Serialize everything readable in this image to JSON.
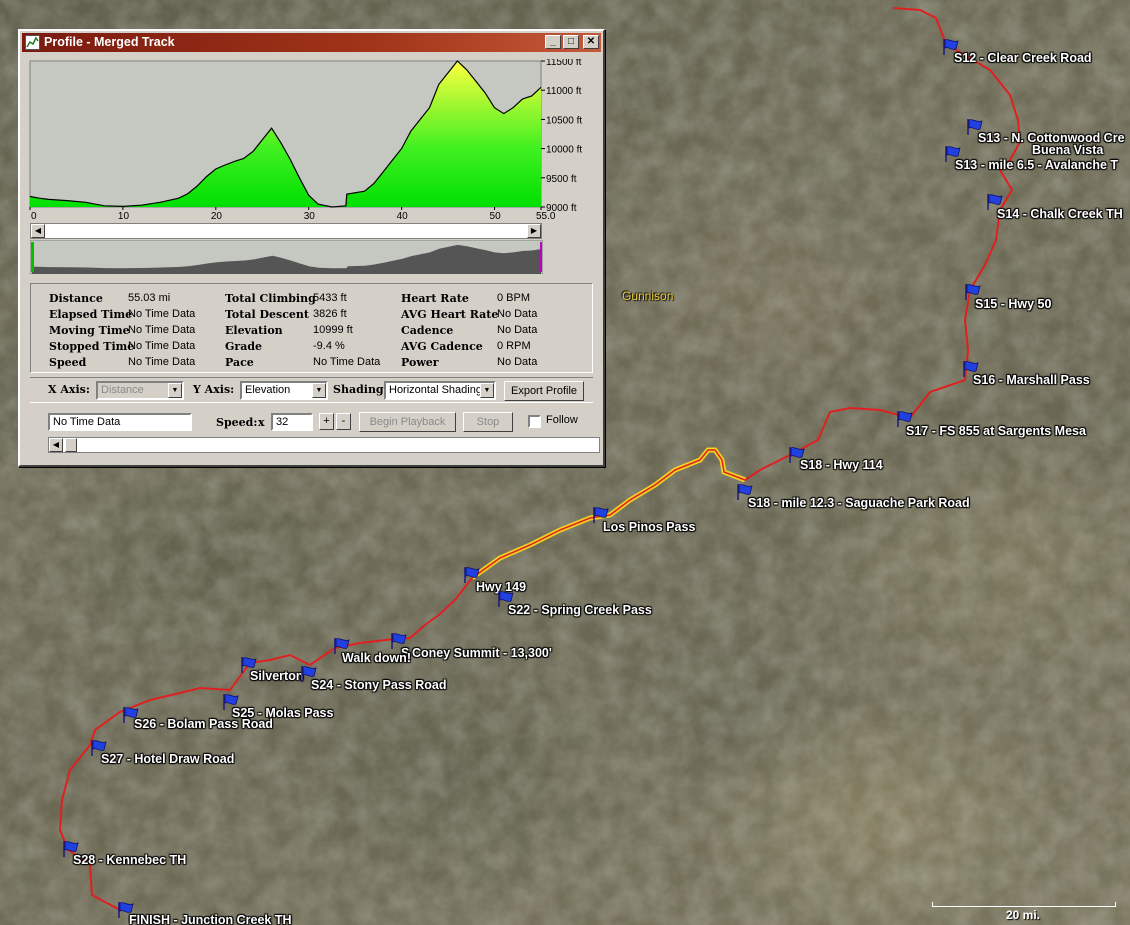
{
  "window": {
    "title": "Profile - Merged Track",
    "minimize_glyph": "_",
    "maximize_glyph": "□",
    "close_glyph": "✕"
  },
  "profile_chart": {
    "y_tick_labels": [
      "11500 ft",
      "11000 ft",
      "10500 ft",
      "10000 ft",
      "9500 ft",
      "9000 ft"
    ],
    "x_tick_labels": [
      "0",
      "10",
      "20",
      "30",
      "40",
      "50",
      "55.0"
    ],
    "x_range": [
      0,
      55
    ],
    "y_range": [
      9000,
      11500
    ],
    "elevation_ft": [
      [
        0,
        9180
      ],
      [
        1,
        9150
      ],
      [
        2,
        9130
      ],
      [
        4,
        9110
      ],
      [
        6,
        9080
      ],
      [
        8,
        9020
      ],
      [
        10,
        9010
      ],
      [
        12,
        9030
      ],
      [
        14,
        9080
      ],
      [
        16,
        9150
      ],
      [
        17,
        9230
      ],
      [
        18,
        9360
      ],
      [
        19,
        9520
      ],
      [
        20,
        9650
      ],
      [
        21,
        9720
      ],
      [
        22,
        9780
      ],
      [
        23,
        9830
      ],
      [
        24,
        9950
      ],
      [
        25,
        10150
      ],
      [
        26,
        10350
      ],
      [
        27,
        10100
      ],
      [
        28,
        9820
      ],
      [
        29,
        9500
      ],
      [
        30,
        9200
      ],
      [
        31,
        9050
      ],
      [
        32.5,
        9000
      ],
      [
        34,
        9020
      ],
      [
        34.1,
        9220
      ],
      [
        36,
        9270
      ],
      [
        37,
        9400
      ],
      [
        38,
        9600
      ],
      [
        39,
        9800
      ],
      [
        40,
        10000
      ],
      [
        41,
        10300
      ],
      [
        42,
        10500
      ],
      [
        43,
        10700
      ],
      [
        44,
        11100
      ],
      [
        45,
        11300
      ],
      [
        46,
        11500
      ],
      [
        47,
        11350
      ],
      [
        48,
        11150
      ],
      [
        49,
        10950
      ],
      [
        50,
        10700
      ],
      [
        51,
        10600
      ],
      [
        52,
        10700
      ],
      [
        53,
        10850
      ],
      [
        54,
        10900
      ],
      [
        55,
        11050
      ]
    ]
  },
  "stats": [
    {
      "label": "Distance",
      "value": "55.03 mi"
    },
    {
      "label": "Elapsed Time",
      "value": "No Time Data"
    },
    {
      "label": "Moving Time",
      "value": "No Time Data"
    },
    {
      "label": "Stopped Time",
      "value": "No Time Data"
    },
    {
      "label": "Speed",
      "value": "No Time Data"
    },
    {
      "label": "Total Climbing",
      "value": "5433 ft"
    },
    {
      "label": "Total Descent",
      "value": "3826 ft"
    },
    {
      "label": "Elevation",
      "value": "10999 ft"
    },
    {
      "label": "Grade",
      "value": "-9.4 %"
    },
    {
      "label": "Pace",
      "value": "No Time Data"
    },
    {
      "label": "Heart Rate",
      "value": "0 BPM"
    },
    {
      "label": "AVG Heart Rate",
      "value": "No Data"
    },
    {
      "label": "Cadence",
      "value": "No Data"
    },
    {
      "label": "AVG Cadence",
      "value": "0 RPM"
    },
    {
      "label": "Power",
      "value": "No Data"
    }
  ],
  "controls": {
    "x_axis_label": "X Axis:",
    "x_axis_value": "Distance",
    "y_axis_label": "Y Axis:",
    "y_axis_value": "Elevation",
    "shading_label": "Shading:",
    "shading_value": "Horizontal Shading",
    "export_label": "Export Profile",
    "time_value": "No Time Data",
    "speed_label": "Speed:",
    "speed_x": "x",
    "speed_value": "32",
    "plus_label": "+",
    "minus_label": "-",
    "begin_label": "Begin Playback",
    "stop_label": "Stop",
    "follow_label": "Follow"
  },
  "map": {
    "city": "Gunnison",
    "scale_label": "20 mi.",
    "waypoints": [
      "S12 - Clear Creek Road",
      "S13 - N. Cottonwood Cre",
      "Buena Vista",
      "S13 - mile 6.5 - Avalanche T",
      "S14 - Chalk Creek TH",
      "S15 - Hwy 50",
      "S16 - Marshall Pass",
      "S17 - FS 855 at Sargents Mesa",
      "S18 - Hwy 114",
      "S18 - mile 12.3 - Saguache Park Road",
      "Los Pinos Pass",
      "Hwy 149",
      "S22 - Spring Creek Pass",
      "S",
      "Coney Summit - 13,300'",
      "Walk down!",
      "Silverton",
      "S24 - Stony Pass Road",
      "S25 - Molas Pass",
      "S26 - Bolam Pass Road",
      "S27 - Hotel Draw Road",
      "S28 - Kennebec TH",
      "FINISH - Junction Creek TH"
    ]
  },
  "colors": {
    "route": "#e02020",
    "highlight": "#f0d020",
    "flag": "#2040e0",
    "fill_top": "#ffff40",
    "fill_bottom": "#00e000",
    "chart_bg": "#c4c8c0"
  }
}
